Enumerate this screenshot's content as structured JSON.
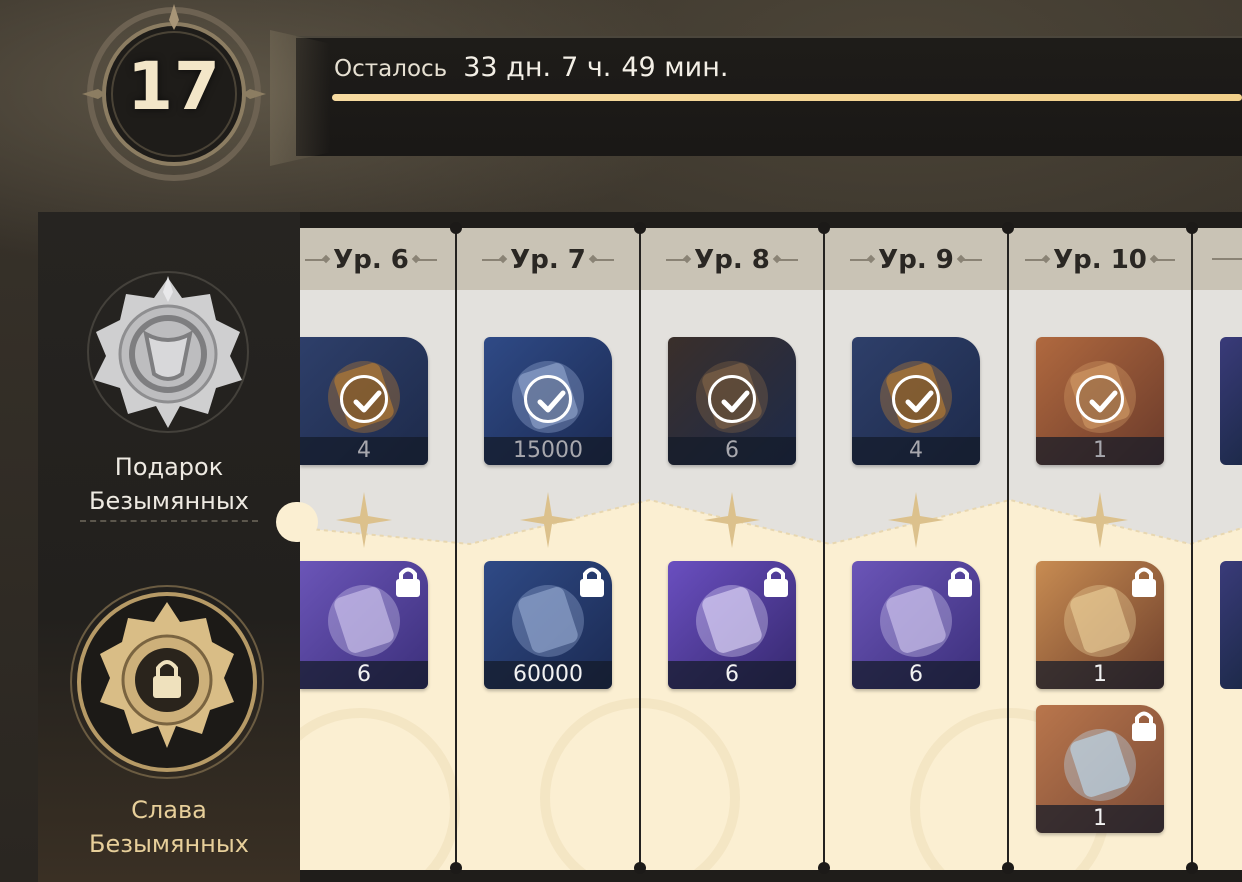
{
  "level": {
    "number": "17"
  },
  "timer": {
    "label": "Осталось",
    "days": "33 дн.",
    "hours": "7 ч.",
    "minutes": "49 мин.",
    "progress_fraction": 1.0
  },
  "tracks": {
    "free": {
      "line1": "Подарок",
      "line2": "Безымянных"
    },
    "paid": {
      "line1": "Слава",
      "line2": "Безымянных"
    }
  },
  "columns": [
    {
      "label": "Ур. 6",
      "free": {
        "count": "4",
        "claimed": true,
        "art": "canister"
      },
      "paid": [
        {
          "count": "6",
          "locked": true,
          "art": "purple-canister"
        }
      ]
    },
    {
      "label": "Ур. 7",
      "free": {
        "count": "15000",
        "claimed": true,
        "art": "credit-card"
      },
      "paid": [
        {
          "count": "60000",
          "locked": true,
          "art": "credit-card"
        }
      ]
    },
    {
      "label": "Ур. 8",
      "free": {
        "count": "6",
        "claimed": true,
        "art": "book"
      },
      "paid": [
        {
          "count": "6",
          "locked": true,
          "art": "purple-book"
        }
      ]
    },
    {
      "label": "Ур. 9",
      "free": {
        "count": "4",
        "claimed": true,
        "art": "canister"
      },
      "paid": [
        {
          "count": "6",
          "locked": true,
          "art": "purple-canister"
        }
      ]
    },
    {
      "label": "Ур. 10",
      "free": {
        "count": "1",
        "claimed": true,
        "art": "ticket"
      },
      "paid": [
        {
          "count": "1",
          "locked": true,
          "art": "gold-ticket"
        },
        {
          "count": "1",
          "locked": true,
          "art": "crystal"
        }
      ]
    }
  ],
  "colors": {
    "gold": "#e7cf9a",
    "progress": "#f4d694",
    "free_bg": "#e3e1dd",
    "paid_bg": "#fbefd2"
  }
}
